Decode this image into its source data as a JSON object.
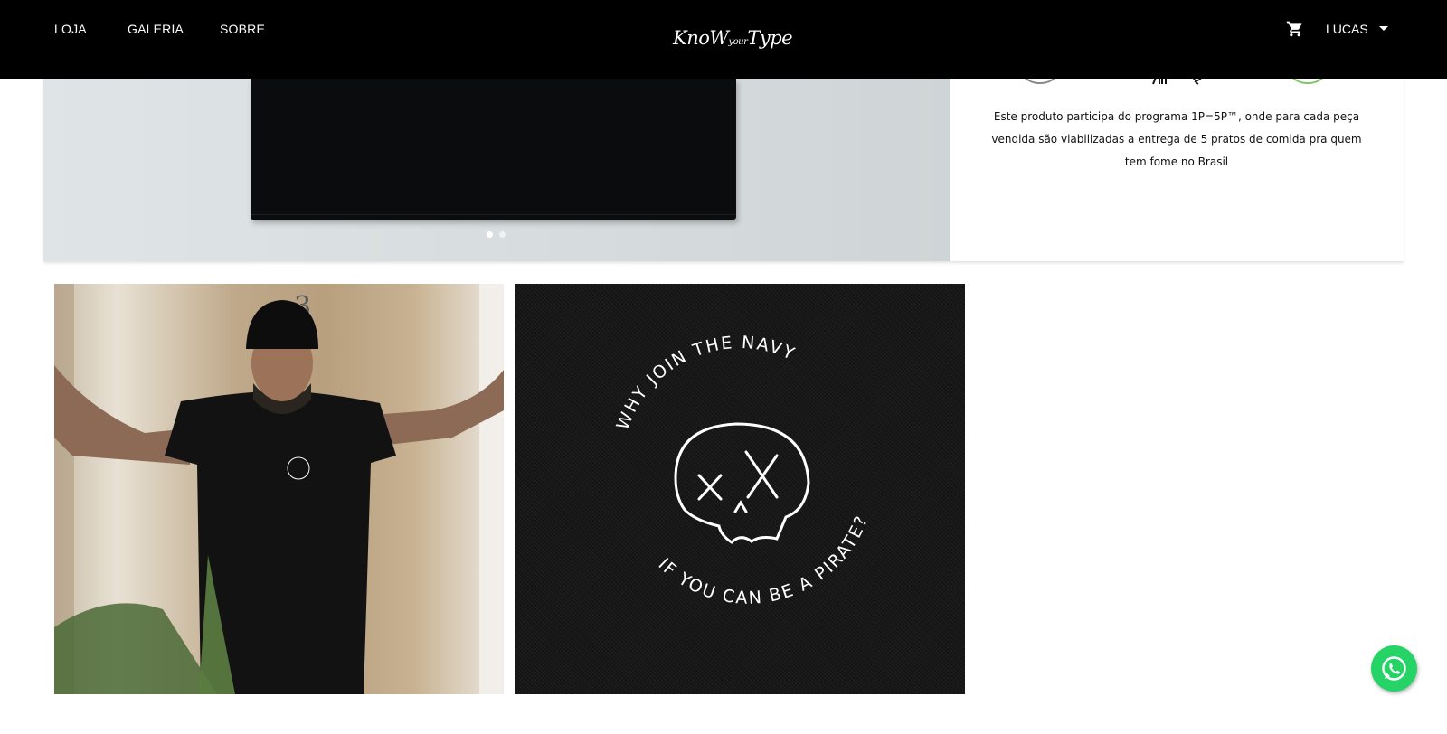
{
  "nav": {
    "links": [
      "LOJA",
      "GALERIA",
      "SOBRE"
    ],
    "logo": {
      "part1": "KnoW",
      "part2": "your",
      "part3": "Type"
    },
    "cart_icon": "cart-icon",
    "user_label": "LUCAS",
    "user_caret_icon": "caret-down-icon"
  },
  "product": {
    "carousel_dots": 2,
    "active_dot": 1,
    "info_text": "Este produto participa do programa 1P=5P™, onde para cada peça vendida são viabilizadas a entrega de 5 pratos de comida pra quem tem fome no Brasil"
  },
  "gallery": {
    "door_number": "3",
    "print_top": "WHY JOIN THE NAVY",
    "print_bottom": "IF YOU CAN BE A PIRATE?"
  },
  "whatsapp": {
    "icon": "whatsapp-icon",
    "color": "#25d366"
  }
}
